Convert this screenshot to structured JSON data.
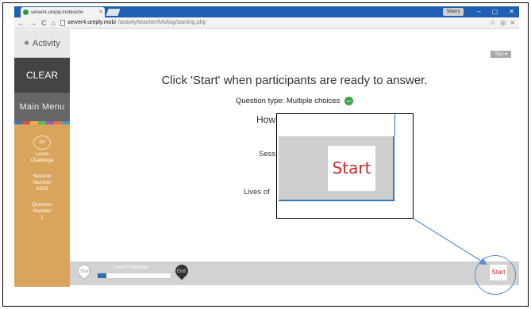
{
  "browser": {
    "tab_title": "server4.ureply.mobi/activ",
    "tab_close": "×",
    "user_badge": "Sherry",
    "window_controls": [
      "–",
      "▢",
      "✕"
    ],
    "nav": {
      "back": "←",
      "forward": "→",
      "reload": "C",
      "home": "⌂"
    },
    "url_host": "server4.ureply.mobi",
    "url_path": "/activity/teacher/lvlofsig/starting.php",
    "toolbar_icons": [
      "☆",
      "◎",
      "≡"
    ]
  },
  "sidebar": {
    "activity_label": "Activity",
    "clear_label": "CLEAR",
    "main_menu_label": "Main Menu",
    "strip_colors": [
      "#3b73b9",
      "#d9534f",
      "#f0ad4e",
      "#5cb85c",
      "#9b59b6",
      "#e5734e",
      "#3aa0c9"
    ],
    "lv_badge": "LV",
    "level_line1": "Level",
    "level_line2": "Challenge",
    "session_line1": "Session",
    "session_line2": "Number",
    "session_value": "A503",
    "question_line1": "Question",
    "question_line2": "Number",
    "question_value": "1"
  },
  "main": {
    "tips_label": "Tips ▾",
    "headline": "Click 'Start' when participants are ready to answer.",
    "question_type": "Question type: Multiple choices",
    "question_type_icon": "MC",
    "trunc_how": "How",
    "trunc_sess": "Sess",
    "trunc_lives": "Lives of"
  },
  "bottombar": {
    "start_pin_label": "Start",
    "level_label": "Level Challenge",
    "progress_fraction": 0.12,
    "end_pin_label": "End",
    "start_button": "Start"
  },
  "zoom": {
    "start_button": "Start"
  },
  "colors": {
    "titlebar": "#1f5fb3",
    "sidebar": "#d9a45c",
    "clear": "#444444",
    "start_red": "#c9282e",
    "callout_blue": "#5a8fd2"
  }
}
